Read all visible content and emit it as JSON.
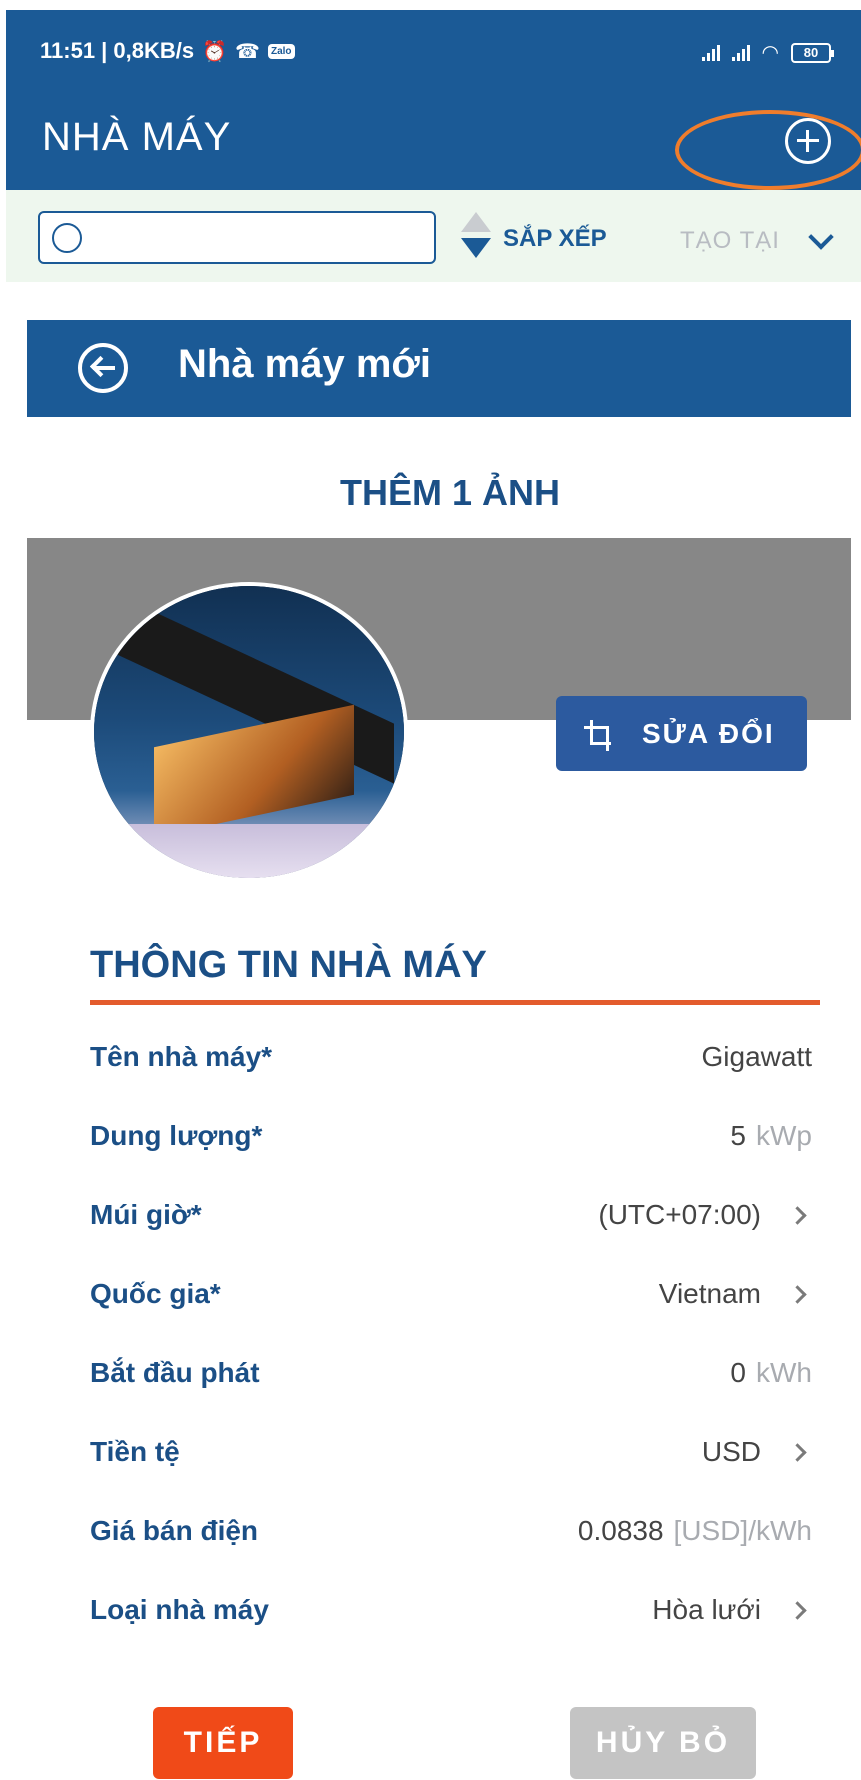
{
  "status_bar": {
    "time_speed": "11:51 | 0,8KB/s",
    "zalo_label": "Zalo",
    "battery": "80"
  },
  "app_bar": {
    "title": "NHÀ MÁY"
  },
  "toolbar": {
    "search_placeholder": "",
    "sort_label": "SẮP XẾP",
    "filter_label": "TẠO TẠI"
  },
  "dialog": {
    "title": "Nhà máy mới",
    "add_photo_label": "THÊM 1 ẢNH",
    "edit_label": "SỬA ĐỔI",
    "section_title": "THÔNG TIN NHÀ MÁY",
    "fields": [
      {
        "label": "Tên nhà máy*",
        "value": "Gigawatt",
        "unit": "",
        "chevron": false
      },
      {
        "label": "Dung lượng*",
        "value": "5",
        "unit": "kWp",
        "chevron": false
      },
      {
        "label": "Múi giờ*",
        "value": "(UTC+07:00)",
        "unit": "",
        "chevron": true
      },
      {
        "label": "Quốc gia*",
        "value": "Vietnam",
        "unit": "",
        "chevron": true
      },
      {
        "label": "Bắt đầu phát",
        "value": "0",
        "unit": "kWh",
        "chevron": false
      },
      {
        "label": "Tiền tệ",
        "value": "USD",
        "unit": "",
        "chevron": true
      },
      {
        "label": "Giá bán điện",
        "value": "0.0838",
        "unit": "[USD]/kWh",
        "chevron": false
      },
      {
        "label": "Loại nhà máy",
        "value": "Hòa lưới",
        "unit": "",
        "chevron": true
      }
    ],
    "next_label": "TIẾP",
    "cancel_label": "HỦY BỎ"
  },
  "colors": {
    "primary": "#1b5a96",
    "accent": "#f04a18",
    "highlight": "#f07d2c"
  }
}
